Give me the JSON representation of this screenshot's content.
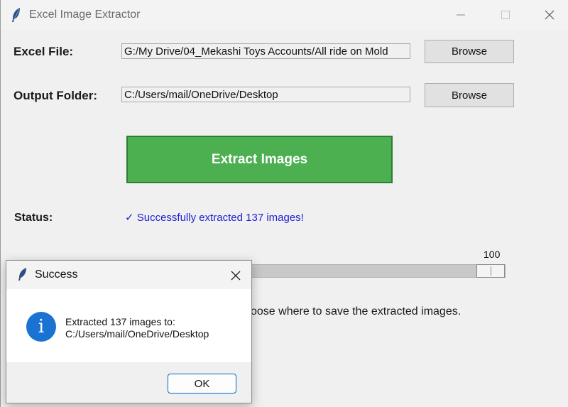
{
  "window": {
    "title": "Excel Image Extractor"
  },
  "excel_file": {
    "label": "Excel File:",
    "value": "G:/My Drive/04_Mekashi Toys Accounts/All ride on Mold",
    "browse_label": "Browse"
  },
  "output_folder": {
    "label": "Output Folder:",
    "value": "C:/Users/mail/OneDrive/Desktop",
    "browse_label": "Browse"
  },
  "extract_button": {
    "label": "Extract Images",
    "color": "#4caf50"
  },
  "status": {
    "label": "Status:",
    "message": "✓ Successfully extracted 137 images!",
    "color": "#1f1fd6"
  },
  "slider": {
    "value": "100",
    "fraction": 1.0
  },
  "hint": {
    "text": "oose where to save the extracted images."
  },
  "dialog": {
    "title": "Success",
    "message_line1": "Extracted 137 images to:",
    "message_line2": "C:/Users/mail/OneDrive/Desktop",
    "ok_label": "OK",
    "icon": "info-icon"
  }
}
